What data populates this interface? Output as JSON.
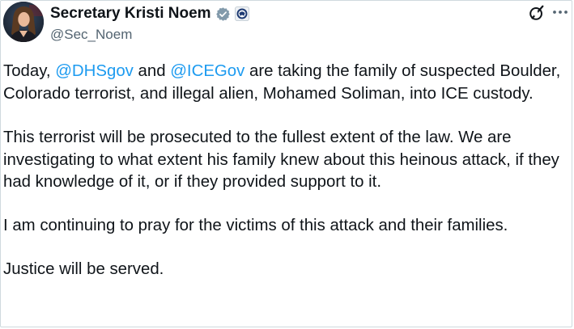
{
  "author": {
    "display_name": "Secretary Kristi Noem",
    "handle": "@Sec_Noem",
    "avatar_icon": "avatar-photo",
    "verified_badge_icon": "government-verified-badge",
    "affiliation_icon": "dhs-seal-icon",
    "badge_color": "#829aab"
  },
  "actions": {
    "grok_icon": "grok-icon",
    "more_icon": "more-options-icon"
  },
  "post": {
    "p1": {
      "prefix": "Today, ",
      "mention1": "@DHSgov",
      "middle": " and ",
      "mention2": "@ICEGov",
      "suffix": " are taking the family of suspected Boulder, Colorado terrorist, and illegal alien, Mohamed Soliman, into ICE custody."
    },
    "p2": "This terrorist will be prosecuted to the fullest extent of the law. We are investigating to what extent his family knew about this heinous attack, if they had knowledge of it, or if they provided support to it.",
    "p3": "I am continuing to pray for the victims of this attack and their families.",
    "p4": "Justice will be served."
  },
  "colors": {
    "link": "#1d9bf0",
    "text": "#0f1419",
    "secondary": "#536471"
  }
}
